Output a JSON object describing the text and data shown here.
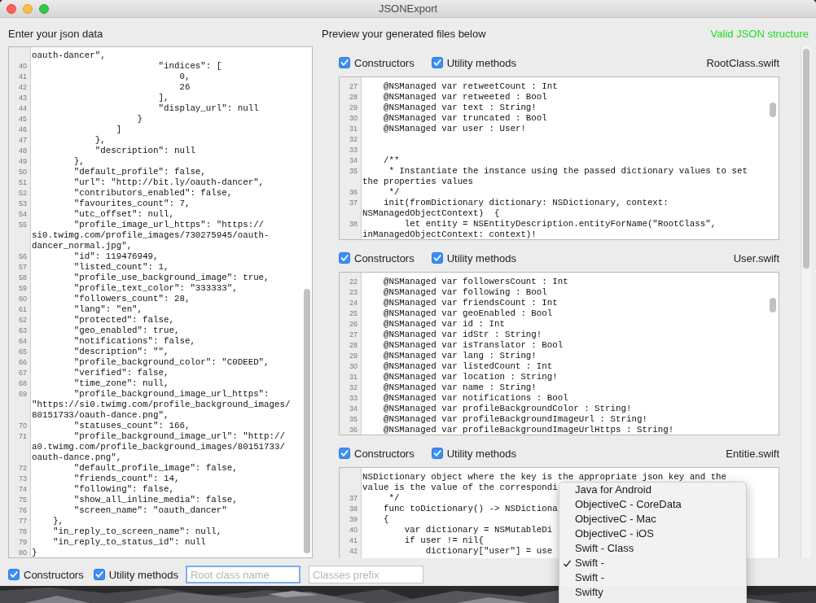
{
  "window": {
    "title": "JSONExport"
  },
  "input": {
    "heading": "Enter your json data",
    "lines": [
      {
        "t": "oauth-dancer\","
      },
      {
        "n": "40",
        "t": "                        \"indices\": ["
      },
      {
        "n": "41",
        "t": "                            0,"
      },
      {
        "n": "42",
        "t": "                            26"
      },
      {
        "n": "43",
        "t": "                        ],"
      },
      {
        "n": "44",
        "t": "                        \"display_url\": null"
      },
      {
        "n": "45",
        "t": "                    }"
      },
      {
        "n": "46",
        "t": "                ]"
      },
      {
        "n": "47",
        "t": "            },"
      },
      {
        "n": "48",
        "t": "            \"description\": null"
      },
      {
        "n": "49",
        "t": "        },"
      },
      {
        "n": "50",
        "t": "        \"default_profile\": false,"
      },
      {
        "n": "51",
        "t": "        \"url\": \"http://bit.ly/oauth-dancer\","
      },
      {
        "n": "52",
        "t": "        \"contributors_enabled\": false,"
      },
      {
        "n": "53",
        "t": "        \"favourites_count\": 7,"
      },
      {
        "n": "54",
        "t": "        \"utc_offset\": null,"
      },
      {
        "n": "55",
        "t": "        \"profile_image_url_https\": \"https://"
      },
      {
        "t": "si0.twimg.com/profile_images/730275945/oauth-"
      },
      {
        "t": "dancer_normal.jpg\","
      },
      {
        "n": "56",
        "t": "        \"id\": 119476949,"
      },
      {
        "n": "57",
        "t": "        \"listed_count\": 1,"
      },
      {
        "n": "58",
        "t": "        \"profile_use_background_image\": true,"
      },
      {
        "n": "59",
        "t": "        \"profile_text_color\": \"333333\","
      },
      {
        "n": "60",
        "t": "        \"followers_count\": 28,"
      },
      {
        "n": "61",
        "t": "        \"lang\": \"en\","
      },
      {
        "n": "62",
        "t": "        \"protected\": false,"
      },
      {
        "n": "63",
        "t": "        \"geo_enabled\": true,"
      },
      {
        "n": "64",
        "t": "        \"notifications\": false,"
      },
      {
        "n": "65",
        "t": "        \"description\": \"\","
      },
      {
        "n": "66",
        "t": "        \"profile_background_color\": \"C0DEED\","
      },
      {
        "n": "67",
        "t": "        \"verified\": false,"
      },
      {
        "n": "68",
        "t": "        \"time_zone\": null,"
      },
      {
        "n": "69",
        "t": "        \"profile_background_image_url_https\":"
      },
      {
        "t": "\"https://si0.twimg.com/profile_background_images/"
      },
      {
        "t": "80151733/oauth-dance.png\","
      },
      {
        "n": "70",
        "t": "        \"statuses_count\": 166,"
      },
      {
        "n": "71",
        "t": "        \"profile_background_image_url\": \"http://"
      },
      {
        "t": "a0.twimg.com/profile_background_images/80151733/"
      },
      {
        "t": "oauth-dance.png\","
      },
      {
        "n": "72",
        "t": "        \"default_profile_image\": false,"
      },
      {
        "n": "73",
        "t": "        \"friends_count\": 14,"
      },
      {
        "n": "74",
        "t": "        \"following\": false,"
      },
      {
        "n": "75",
        "t": "        \"show_all_inline_media\": false,"
      },
      {
        "n": "76",
        "t": "        \"screen_name\": \"oauth_dancer\""
      },
      {
        "n": "77",
        "t": "    },"
      },
      {
        "n": "78",
        "t": "    \"in_reply_to_screen_name\": null,"
      },
      {
        "n": "79",
        "t": "    \"in_reply_to_status_id\": null"
      },
      {
        "n": "80",
        "t": "}"
      }
    ]
  },
  "preview": {
    "heading": "Preview your generated files below",
    "status": {
      "text": "Valid JSON structure",
      "valid": true
    },
    "files": [
      {
        "name": "RootClass.swift",
        "options": [
          {
            "label": "Constructors",
            "checked": true
          },
          {
            "label": "Utility methods",
            "checked": true
          }
        ],
        "lines": [
          {
            "n": "27",
            "t": "    @NSManaged var retweetCount : Int"
          },
          {
            "n": "28",
            "t": "    @NSManaged var retweeted : Bool"
          },
          {
            "n": "29",
            "t": "    @NSManaged var text : String!"
          },
          {
            "n": "30",
            "t": "    @NSManaged var truncated : Bool"
          },
          {
            "n": "31",
            "t": "    @NSManaged var user : User!"
          },
          {
            "n": "32"
          },
          {
            "n": "33"
          },
          {
            "n": "34",
            "t": "    /**"
          },
          {
            "n": "35",
            "t": "     * Instantiate the instance using the passed dictionary values to set"
          },
          {
            "t": "the properties values"
          },
          {
            "n": "36",
            "t": "     */"
          },
          {
            "n": "37",
            "t": "    init(fromDictionary dictionary: NSDictionary, context:"
          },
          {
            "t": "NSManagedObjectContext)  {"
          },
          {
            "n": "38",
            "t": "        let entity = NSEntityDescription.entityForName(\"RootClass\","
          },
          {
            "t": "inManagedObjectContext: context)!"
          }
        ]
      },
      {
        "name": "User.swift",
        "options": [
          {
            "label": "Constructors",
            "checked": true
          },
          {
            "label": "Utility methods",
            "checked": true
          }
        ],
        "lines": [
          {
            "n": "22",
            "t": "    @NSManaged var followersCount : Int"
          },
          {
            "n": "23",
            "t": "    @NSManaged var following : Bool"
          },
          {
            "n": "24",
            "t": "    @NSManaged var friendsCount : Int"
          },
          {
            "n": "25",
            "t": "    @NSManaged var geoEnabled : Bool"
          },
          {
            "n": "26",
            "t": "    @NSManaged var id : Int"
          },
          {
            "n": "27",
            "t": "    @NSManaged var idStr : String!"
          },
          {
            "n": "28",
            "t": "    @NSManaged var isTranslator : Bool"
          },
          {
            "n": "29",
            "t": "    @NSManaged var lang : String!"
          },
          {
            "n": "30",
            "t": "    @NSManaged var listedCount : Int"
          },
          {
            "n": "31",
            "t": "    @NSManaged var location : String!"
          },
          {
            "n": "32",
            "t": "    @NSManaged var name : String!"
          },
          {
            "n": "33",
            "t": "    @NSManaged var notifications : Bool"
          },
          {
            "n": "34",
            "t": "    @NSManaged var profileBackgroundColor : String!"
          },
          {
            "n": "35",
            "t": "    @NSManaged var profileBackgroundImageUrl : String!"
          },
          {
            "n": "36",
            "t": "    @NSManaged var profileBackgroundImageUrlHttps : String!"
          }
        ]
      },
      {
        "name": "Entitie.swift",
        "options": [
          {
            "label": "Constructors",
            "checked": true
          },
          {
            "label": "Utility methods",
            "checked": true
          }
        ],
        "lines": [
          {
            "t": "NSDictionary object where the key is the appropriate json key and the"
          },
          {
            "t": "value is the value of the correspondi"
          },
          {
            "n": "37",
            "t": "     */"
          },
          {
            "n": "38",
            "t": "    func toDictionary() -> NSDictiona"
          },
          {
            "n": "39",
            "t": "    {"
          },
          {
            "n": "40",
            "t": "        var dictionary = NSMutableDi"
          },
          {
            "n": "41",
            "t": "        if user != nil{"
          },
          {
            "n": "42",
            "t": "            dictionary[\"user\"] = use"
          }
        ]
      }
    ]
  },
  "bottom_bar": {
    "options": [
      {
        "label": "Constructors",
        "checked": true
      },
      {
        "label": "Utility methods",
        "checked": true
      }
    ],
    "fields": [
      {
        "placeholder": "Root class name",
        "focused": true
      },
      {
        "placeholder": "Classes prefix",
        "focused": false
      }
    ]
  },
  "language_menu": {
    "items": [
      {
        "label": "Java for Android",
        "selected": false
      },
      {
        "label": "ObjectiveC - CoreData",
        "selected": false
      },
      {
        "label": "ObjectiveC - Mac",
        "selected": false
      },
      {
        "label": "ObjectiveC - iOS",
        "selected": false
      },
      {
        "label": "Swift - Class",
        "selected": false
      },
      {
        "label": "Swift -",
        "selected": true
      },
      {
        "label": "Swift -",
        "selected": false
      },
      {
        "label": "Swifty",
        "selected": false
      }
    ]
  }
}
